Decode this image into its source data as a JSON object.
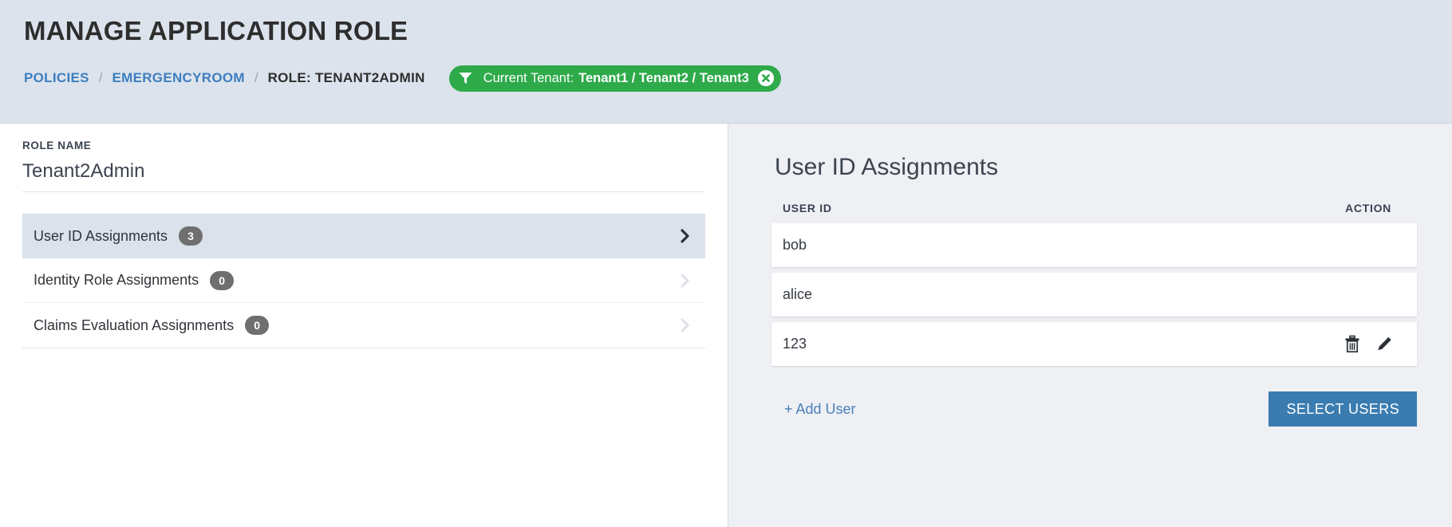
{
  "header": {
    "title": "MANAGE APPLICATION ROLE",
    "breadcrumb": {
      "policies": "POLICIES",
      "application": "EMERGENCYROOM",
      "separator": "/",
      "current": "ROLE: TENANT2ADMIN"
    },
    "tenant_badge": {
      "label": "Current Tenant:",
      "value": "Tenant1 / Tenant2 / Tenant3",
      "icon": "funnel-icon",
      "clear_icon": "close-circle-icon",
      "background_color": "#2eaa4a"
    }
  },
  "left_pane": {
    "role_name_label": "ROLE NAME",
    "role_name_value": "Tenant2Admin",
    "assignments": [
      {
        "label": "User ID Assignments",
        "count": "3",
        "active": true
      },
      {
        "label": "Identity Role Assignments",
        "count": "0",
        "active": false
      },
      {
        "label": "Claims Evaluation Assignments",
        "count": "0",
        "active": false
      }
    ]
  },
  "right_pane": {
    "title": "User ID Assignments",
    "columns": {
      "user_id": "USER ID",
      "action": "ACTION"
    },
    "rows": [
      {
        "user_id": "bob",
        "has_actions": false
      },
      {
        "user_id": "alice",
        "has_actions": false
      },
      {
        "user_id": "123",
        "has_actions": true
      }
    ],
    "row_action_icons": {
      "delete": "trash-icon",
      "edit": "pencil-icon"
    },
    "add_user_link": "+ Add User",
    "select_users_button": "SELECT USERS",
    "button_color": "#3a7cb0"
  }
}
